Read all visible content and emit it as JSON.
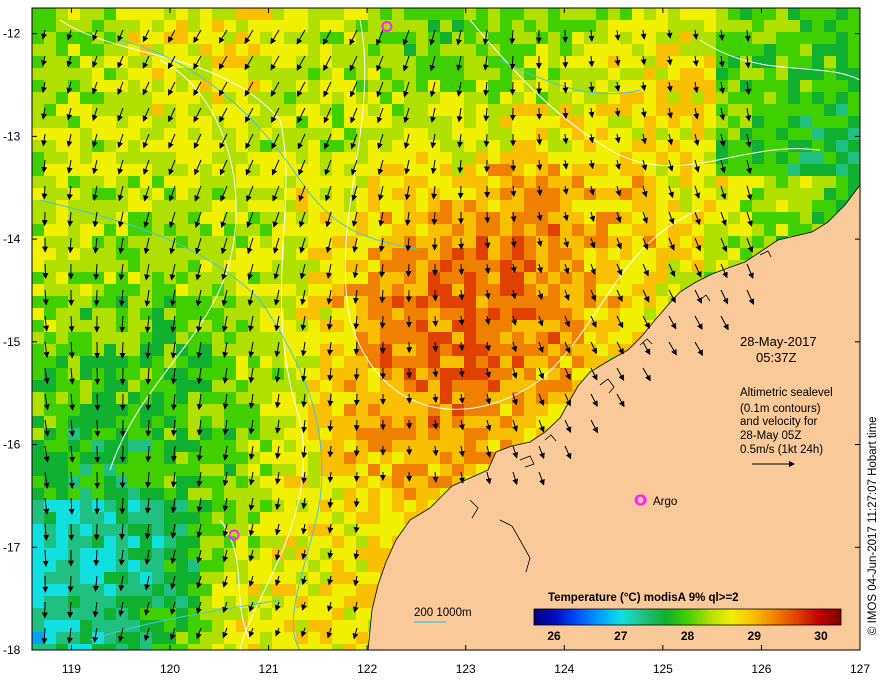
{
  "map": {
    "lon_range": [
      118.6,
      127.0
    ],
    "lat_range": [
      -18.0,
      -11.75
    ],
    "x_ticks": [
      "119",
      "120",
      "121",
      "122",
      "123",
      "124",
      "125",
      "126",
      "127"
    ],
    "y_ticks": [
      "-12",
      "-13",
      "-14",
      "-15",
      "-16",
      "-17",
      "-18"
    ],
    "land_color": "#f9c99a",
    "contour_color": "#ffffff",
    "isobath_color": "#3fc8e8"
  },
  "annotation": {
    "date": "28-May-2017",
    "time": "05:37Z",
    "lines": [
      "Altimetric sealevel",
      "(0.1m contours)",
      "and velocity for",
      "28-May 05Z",
      "0.5m/s (1kt 24h)"
    ]
  },
  "argo": {
    "label": "Argo",
    "color": "#ff20ff",
    "points": [
      [
        124.78,
        -16.54
      ],
      [
        120.65,
        -16.88
      ],
      [
        122.2,
        -11.93
      ]
    ]
  },
  "isobath_legend": "200  1000m",
  "credit": "© IMOS 04-Jun-2017 11:27:07 Hobart time",
  "colorbar": {
    "title": "Temperature (°C) modisA 9% ql>=2",
    "ticks": [
      "26",
      "27",
      "28",
      "29",
      "30"
    ],
    "range": [
      25.7,
      30.3
    ],
    "colors": [
      "#00007f",
      "#0010c0",
      "#0050ff",
      "#00a0ff",
      "#10e0e0",
      "#20c080",
      "#10b030",
      "#40d000",
      "#b0e000",
      "#f0f000",
      "#f8c000",
      "#f08000",
      "#e04000",
      "#c00000",
      "#800000"
    ]
  }
}
